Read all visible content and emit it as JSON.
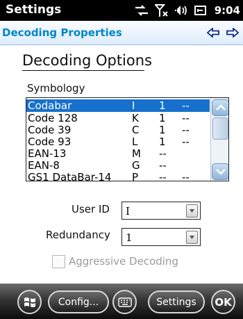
{
  "status_bar": {
    "title": "Settings",
    "time": "9:04"
  },
  "header": {
    "title": "Decoding Properties"
  },
  "section_title": "Decoding Options",
  "symbology": {
    "label": "Symbology",
    "rows": [
      {
        "name": "Codabar",
        "code": "I",
        "value": "1",
        "extra": "--",
        "selected": true
      },
      {
        "name": "Code 128",
        "code": "K",
        "value": "1",
        "extra": "--"
      },
      {
        "name": "Code 39",
        "code": "C",
        "value": "1",
        "extra": "--"
      },
      {
        "name": "Code 93",
        "code": "L",
        "value": "1",
        "extra": "--"
      },
      {
        "name": "EAN-13",
        "code": "M",
        "value": "--",
        "extra": ""
      },
      {
        "name": "EAN-8",
        "code": "G",
        "value": "--",
        "extra": ""
      },
      {
        "name": "GS1 DataBar-14",
        "code": "P",
        "value": "--",
        "extra": "--"
      }
    ]
  },
  "user_id": {
    "label": "User ID",
    "value": "I"
  },
  "redundancy": {
    "label": "Redundancy",
    "value": "1"
  },
  "aggressive": {
    "label": "Aggressive Decoding",
    "checked": false,
    "enabled": false
  },
  "taskbar": {
    "config_label": "Config...",
    "settings_label": "Settings",
    "ok_label": "OK"
  },
  "colors": {
    "accent": "#0086c7",
    "selection": "#1670cc",
    "taskbar": "#1a1a1a"
  }
}
